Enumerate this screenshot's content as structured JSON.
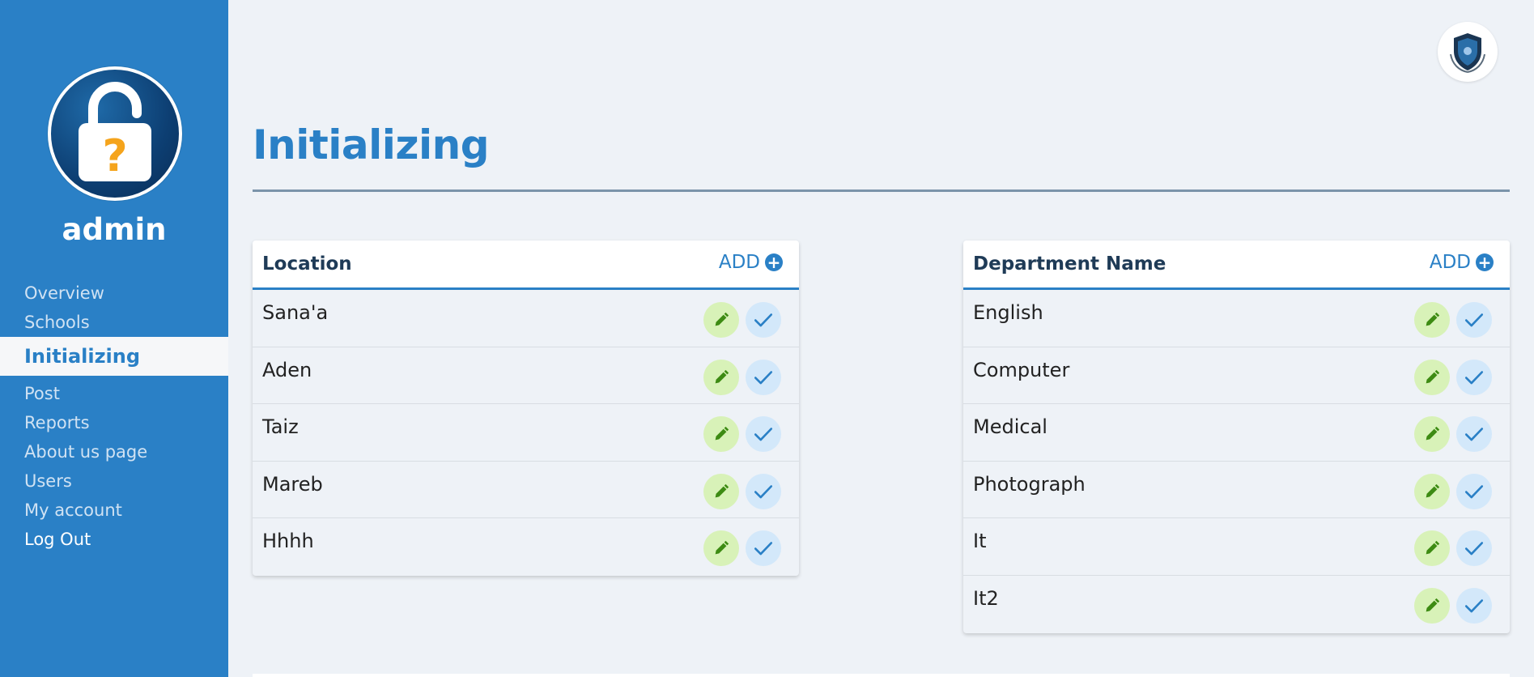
{
  "user": {
    "name": "admin",
    "avatar_icon": "lock-question-icon"
  },
  "nav": {
    "items": [
      {
        "label": "Overview"
      },
      {
        "label": "Schools"
      },
      {
        "label": "Initializing"
      },
      {
        "label": "Post"
      },
      {
        "label": "Reports"
      },
      {
        "label": "About us page"
      },
      {
        "label": "Users"
      },
      {
        "label": "My account"
      },
      {
        "label": "Log Out"
      }
    ],
    "active_index": 2
  },
  "page": {
    "title": "Initializing"
  },
  "location_card": {
    "header": "Location",
    "add_label": "ADD",
    "rows": [
      "Sana'a",
      "Aden",
      "Taiz",
      "Mareb",
      "Hhhh"
    ]
  },
  "department_card": {
    "header": "Department Name",
    "add_label": "ADD",
    "rows": [
      "English",
      "Computer",
      "Medical",
      "Photograph",
      "It",
      "It2"
    ]
  },
  "colors": {
    "accent": "#2a80c6",
    "edit_bg": "#d8f2b8",
    "edit_icon": "#3d8b13",
    "check_bg": "#d3e8fa",
    "check_icon": "#2a80c6"
  }
}
